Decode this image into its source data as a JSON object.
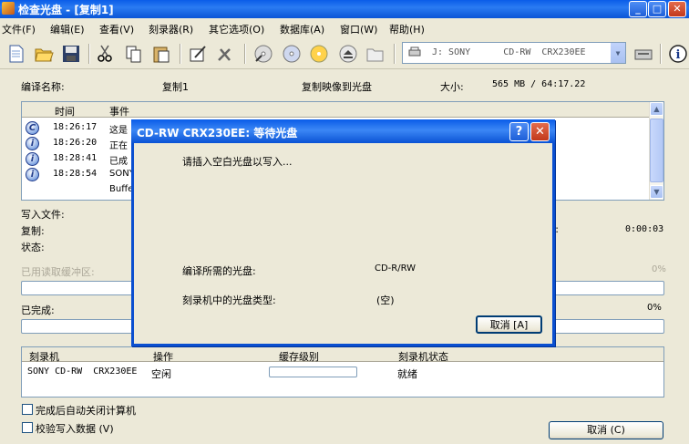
{
  "window": {
    "title": "检查光盘 - [复制1]",
    "min": "_",
    "max": "□",
    "close": "✕"
  },
  "menu": [
    "文件(F)",
    "编辑(E)",
    "查看(V)",
    "刻录器(R)",
    "其它选项(O)",
    "数据库(A)",
    "窗口(W)",
    "帮助(H)"
  ],
  "drive": {
    "value": "J: SONY      CD-RW  CRX230EE"
  },
  "info": {
    "compile_name_label": "编译名称:",
    "compile_name": "复制1",
    "mode": "复制映像到光盘",
    "size_label": "大小:",
    "size": "565 MB  / 64:17.22"
  },
  "log": {
    "col_time": "时间",
    "col_event": "事件",
    "rows": [
      {
        "icon": "C",
        "time": "18:26:17",
        "event": "这是"
      },
      {
        "icon": "i",
        "time": "18:26:20",
        "event": "正在"
      },
      {
        "icon": "i",
        "time": "18:28:41",
        "event": "已成"
      },
      {
        "icon": "i",
        "time": "18:28:54",
        "event": "SONY"
      },
      {
        "icon": "",
        "time": "",
        "event": "Buffe"
      }
    ]
  },
  "status": {
    "write_file": "写入文件:",
    "copy": "复制:",
    "state": "状态:",
    "time_right": "0:00:03",
    "bracket": "]:"
  },
  "read_buffer": {
    "label": "已用读取缓冲区:",
    "pct": "0%"
  },
  "completed": {
    "label": "已完成:",
    "pct": "0%"
  },
  "burners": {
    "headers": [
      "刻录机",
      "操作",
      "缓存级别",
      "刻录机状态"
    ],
    "row": {
      "name": "SONY CD-RW  CRX230EE",
      "op": "空闲",
      "status": "就绪",
      "buffer_level": 0
    }
  },
  "options": {
    "auto_shutdown": "完成后自动关闭计算机",
    "verify": "校验写入数据 (V)"
  },
  "cancel_button": "取消 (C)",
  "dialog": {
    "title": "CD-RW  CRX230EE: 等待光盘",
    "help": "?",
    "close": "✕",
    "message": "请插入空白光盘以写入...",
    "required_label": "编译所需的光盘:",
    "required_value": "CD-R/RW",
    "current_label": "刻录机中的光盘类型:",
    "current_value": "(空)",
    "cancel": "取消 [A]"
  }
}
